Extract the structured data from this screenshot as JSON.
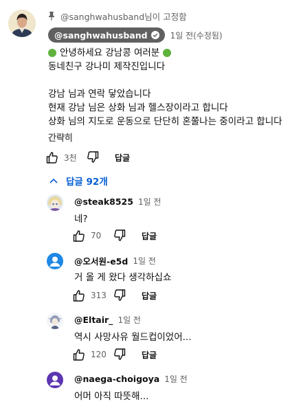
{
  "pinned": {
    "label": "@sanghwahusband님이 고정함"
  },
  "comment": {
    "author": "@sanghwahusband",
    "time": "1일 전(수정됨)",
    "lines": [
      "안녕하세요 강남콩 여러분",
      "동네친구 강나미 제작진입니다",
      "",
      "강남 님과 연락 닿았습니다",
      "현재 강남 님은 상화 님과 헬스장이라고 합니다",
      "상화 님의 지도로 운동으로 단단히 혼쭐나는 중이라고 합니다"
    ],
    "collapse_label": "간략히",
    "likes": "3천",
    "reply_label": "답글"
  },
  "replies_toggle": {
    "label": "답글 92개"
  },
  "replies": [
    {
      "author": "@steak8525",
      "time": "1일 전",
      "text": "네?",
      "likes": "70",
      "reply_label": "답글"
    },
    {
      "author": "@오서원-e5d",
      "time": "1일 전",
      "text": "거 올 게 왔다 생각하십쇼",
      "likes": "313",
      "reply_label": "답글"
    },
    {
      "author": "@Eltair_",
      "time": "1일 전",
      "text": "역시 사망사유 월드컵이었어...",
      "likes": "120",
      "reply_label": "답글"
    },
    {
      "author": "@naega-choigoya",
      "time": "1일 전",
      "text": "어머 아직 따뜻해..."
    }
  ],
  "colors": {
    "link_blue": "#065fd4",
    "secondary_text": "#606060",
    "emoji_green": "#5fb23c",
    "avatar_blue": "#1e88e5",
    "avatar_purple": "#5e35b1"
  },
  "icons": [
    "pin-icon",
    "verified-icon",
    "like-icon",
    "dislike-icon",
    "chevron-up-icon",
    "person-icon"
  ]
}
